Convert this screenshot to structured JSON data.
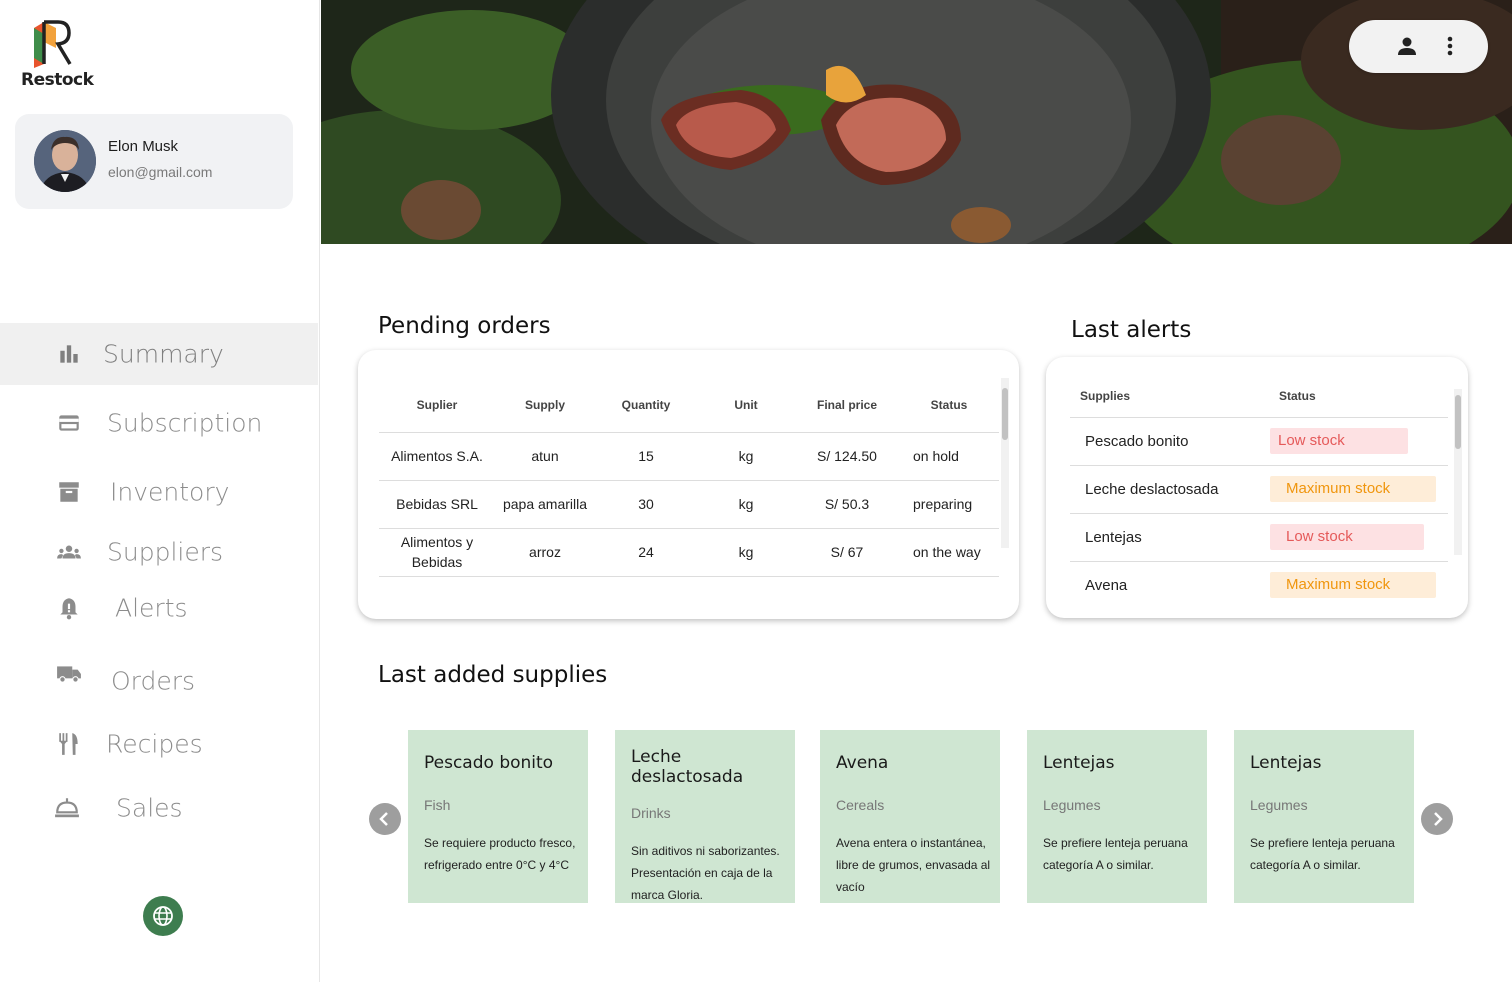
{
  "brand": {
    "name": "Restock",
    "accent": "#3e7d4f"
  },
  "user": {
    "name": "Elon Musk",
    "email": "elon@gmail.com"
  },
  "sidebar": {
    "items": [
      {
        "label": "Summary",
        "icon": "bar-chart-icon",
        "active": true
      },
      {
        "label": "Subscription",
        "icon": "credit-card-icon"
      },
      {
        "label": "Inventory",
        "icon": "archive-box-icon"
      },
      {
        "label": "Suppliers",
        "icon": "group-icon"
      },
      {
        "label": "Alerts",
        "icon": "bell-alert-icon"
      },
      {
        "label": "Orders",
        "icon": "truck-icon"
      },
      {
        "label": "Recipes",
        "icon": "fork-knife-icon"
      },
      {
        "label": "Sales",
        "icon": "room-service-icon"
      }
    ],
    "language_icon": "globe-icon"
  },
  "header": {
    "actions": [
      "person-icon",
      "more-vertical-icon"
    ]
  },
  "pending_orders": {
    "title": "Pending orders",
    "columns": [
      "Suplier",
      "Supply",
      "Quantity",
      "Unit",
      "Final price",
      "Status"
    ],
    "rows": [
      [
        "Alimentos S.A.",
        "atun",
        "15",
        "kg",
        "S/ 124.50",
        "on hold"
      ],
      [
        "Bebidas SRL",
        "papa amarilla",
        "30",
        "kg",
        "S/ 50.3",
        "preparing"
      ],
      [
        "Alimentos y Bebidas",
        "arroz",
        "24",
        "kg",
        "S/ 67",
        "on the way"
      ]
    ]
  },
  "last_alerts": {
    "title": "Last alerts",
    "columns": [
      "Supplies",
      "Status"
    ],
    "rows": [
      {
        "supply": "Pescado bonito",
        "status": "Low stock",
        "type": "low"
      },
      {
        "supply": "Leche deslactosada",
        "status": "Maximum stock",
        "type": "max"
      },
      {
        "supply": "Lentejas",
        "status": "Low stock",
        "type": "low"
      },
      {
        "supply": "Avena",
        "status": "Maximum stock",
        "type": "max"
      }
    ],
    "colors": {
      "low_bg": "#fde1e3",
      "low_text": "#e55a5a",
      "max_bg": "#feedd8",
      "max_text": "#f0960e"
    }
  },
  "last_supplies": {
    "title": "Last added supplies",
    "card_color": "#cfe6d2",
    "cards": [
      {
        "name": "Pescado bonito",
        "category": "Fish",
        "description": "Se requiere producto fresco, refrigerado entre 0°C y 4°C"
      },
      {
        "name": "Leche deslactosada",
        "category": "Drinks",
        "description": "Sin aditivos ni saborizantes. Presentación en caja de la marca Gloria."
      },
      {
        "name": "Avena",
        "category": "Cereals",
        "description": "Avena entera o instantánea, libre de grumos, envasada al vacío"
      },
      {
        "name": "Lentejas",
        "category": "Legumes",
        "description": "Se prefiere lenteja peruana categoría A o similar."
      },
      {
        "name": "Lentejas",
        "category": "Legumes",
        "description": "Se prefiere lenteja peruana categoría A o similar."
      }
    ],
    "prev_icon": "chevron-left-icon",
    "next_icon": "chevron-right-icon"
  }
}
